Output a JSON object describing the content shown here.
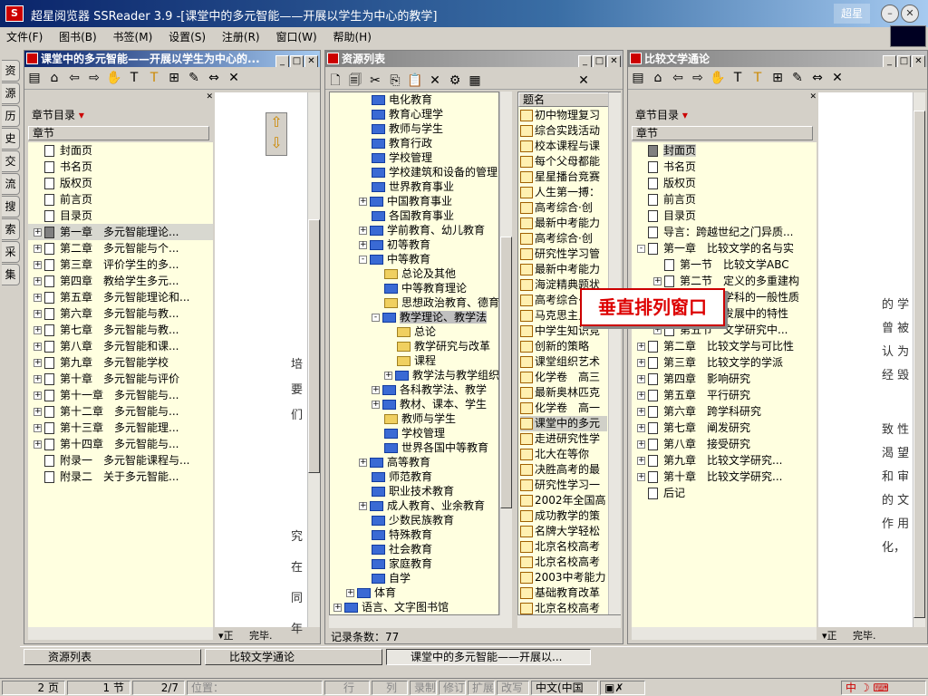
{
  "app": {
    "title": "超星阅览器 SSReader 3.9 -[课堂中的多元智能——开展以学生为中心的教学]",
    "logo_text": "超星"
  },
  "menu": [
    "文件(F)",
    "图书(B)",
    "书签(M)",
    "设置(S)",
    "注册(R)",
    "窗口(W)",
    "帮助(H)"
  ],
  "left_tabs": [
    "资",
    "源",
    "历",
    "史",
    "交",
    "流",
    "搜",
    "索",
    "采",
    "集"
  ],
  "pane1": {
    "title": "课堂中的多元智能——开展以学生为中心的...",
    "toc_dropdown": "章节目录",
    "column": "章节",
    "items": [
      {
        "label": "封面页",
        "expander": false
      },
      {
        "label": "书名页",
        "expander": false
      },
      {
        "label": "版权页",
        "expander": false
      },
      {
        "label": "前言页",
        "expander": false
      },
      {
        "label": "目录页",
        "expander": false
      },
      {
        "label": "第一章　多元智能理论...",
        "expander": true,
        "selected": true
      },
      {
        "label": "第二章　多元智能与个...",
        "expander": true
      },
      {
        "label": "第三章　评价学生的多...",
        "expander": true
      },
      {
        "label": "第四章　教给学生多元...",
        "expander": true
      },
      {
        "label": "第五章　多元智能理论和...",
        "expander": true
      },
      {
        "label": "第六章　多元智能与教...",
        "expander": true
      },
      {
        "label": "第七章　多元智能与教...",
        "expander": true
      },
      {
        "label": "第八章　多元智能和课...",
        "expander": true
      },
      {
        "label": "第九章　多元智能学校",
        "expander": true
      },
      {
        "label": "第十章　多元智能与评价",
        "expander": true
      },
      {
        "label": "第十一章　多元智能与...",
        "expander": true
      },
      {
        "label": "第十二章　多元智能与...",
        "expander": true
      },
      {
        "label": "第十三章　多元智能理...",
        "expander": true
      },
      {
        "label": "第十四章　多元智能与...",
        "expander": true
      },
      {
        "label": "附录一　多元智能课程与...",
        "expander": false
      },
      {
        "label": "附录二　关于多元智能...",
        "expander": false
      }
    ],
    "doc_chars": [
      "培",
      "要",
      "们",
      "究",
      "在",
      "同",
      "年",
      "在"
    ],
    "status": [
      "▾正",
      "完毕."
    ]
  },
  "pane2": {
    "title": "资源列表",
    "tree": [
      {
        "label": "电化教育",
        "indent": 3,
        "icon": "blue"
      },
      {
        "label": "教育心理学",
        "indent": 3,
        "icon": "blue"
      },
      {
        "label": "教师与学生",
        "indent": 3,
        "icon": "blue"
      },
      {
        "label": "教育行政",
        "indent": 3,
        "icon": "blue"
      },
      {
        "label": "学校管理",
        "indent": 3,
        "icon": "blue"
      },
      {
        "label": "学校建筑和设备的管理",
        "indent": 3,
        "icon": "blue"
      },
      {
        "label": "世界教育事业",
        "indent": 3,
        "icon": "blue"
      },
      {
        "label": "中国教育事业",
        "indent": 2,
        "icon": "tree",
        "ex": "+"
      },
      {
        "label": "各国教育事业",
        "indent": 3,
        "icon": "blue"
      },
      {
        "label": "学前教育、幼儿教育",
        "indent": 2,
        "icon": "tree",
        "ex": "+"
      },
      {
        "label": "初等教育",
        "indent": 2,
        "icon": "tree",
        "ex": "+"
      },
      {
        "label": "中等教育",
        "indent": 2,
        "icon": "tree",
        "ex": "-"
      },
      {
        "label": "总论及其他",
        "indent": 4,
        "icon": "yellow"
      },
      {
        "label": "中等教育理论",
        "indent": 4,
        "icon": "blue"
      },
      {
        "label": "思想政治教育、德育",
        "indent": 4,
        "icon": "yellow"
      },
      {
        "label": "教学理论、教学法",
        "indent": 3,
        "icon": "tree",
        "ex": "-",
        "selected": true
      },
      {
        "label": "总论",
        "indent": 5,
        "icon": "yellow"
      },
      {
        "label": "教学研究与改革",
        "indent": 5,
        "icon": "yellow"
      },
      {
        "label": "课程",
        "indent": 5,
        "icon": "yellow"
      },
      {
        "label": "教学法与教学组织",
        "indent": 4,
        "icon": "tree",
        "ex": "+"
      },
      {
        "label": "各科教学法、教学",
        "indent": 3,
        "icon": "tree",
        "ex": "+"
      },
      {
        "label": "教材、课本、学生",
        "indent": 3,
        "icon": "tree",
        "ex": "+"
      },
      {
        "label": "教师与学生",
        "indent": 4,
        "icon": "yellow"
      },
      {
        "label": "学校管理",
        "indent": 4,
        "icon": "blue"
      },
      {
        "label": "世界各国中等教育",
        "indent": 4,
        "icon": "blue"
      },
      {
        "label": "高等教育",
        "indent": 2,
        "icon": "tree",
        "ex": "+"
      },
      {
        "label": "师范教育",
        "indent": 3,
        "icon": "blue"
      },
      {
        "label": "职业技术教育",
        "indent": 3,
        "icon": "blue"
      },
      {
        "label": "成人教育、业余教育",
        "indent": 2,
        "icon": "tree",
        "ex": "+"
      },
      {
        "label": "少数民族教育",
        "indent": 3,
        "icon": "blue"
      },
      {
        "label": "特殊教育",
        "indent": 3,
        "icon": "blue"
      },
      {
        "label": "社会教育",
        "indent": 3,
        "icon": "blue"
      },
      {
        "label": "家庭教育",
        "indent": 3,
        "icon": "blue"
      },
      {
        "label": "自学",
        "indent": 3,
        "icon": "blue"
      },
      {
        "label": "体育",
        "indent": 1,
        "icon": "tree",
        "ex": "+"
      },
      {
        "label": "语言、文字图书馆",
        "indent": 0,
        "icon": "home",
        "ex": "+"
      }
    ],
    "list_header": "题名",
    "list": [
      "初中物理复习",
      "综合实践活动",
      "校本课程与课",
      "每个父母都能",
      "星星播台竞赛",
      "人生第一搏：",
      "高考综合·创",
      "最新中考能力",
      "高考综合·创",
      "研究性学习管",
      "最新中考能力",
      "海淀精典题状",
      "高考综合·创",
      "马克思主义",
      "中学生知识竞",
      "创新的策略",
      "课堂组织艺术",
      "化学卷　高三",
      "最新奥林匹克",
      "化学卷　高一",
      "课堂中的多元",
      "走进研究性学",
      "北大在等你",
      "决胜高考的最",
      "研究性学习一",
      "2002年全国高",
      "成功教学的策",
      "名牌大学轻松",
      "北京名校高考",
      "北京名校高考",
      "2003中考能力",
      "基础教育改革",
      "北京名校高考"
    ],
    "record_count": "记录条数：77"
  },
  "pane3": {
    "title": "比较文学通论",
    "toc_dropdown": "章节目录",
    "column": "章节",
    "items": [
      {
        "label": "封面页",
        "indent": 0,
        "selected": true
      },
      {
        "label": "书名页",
        "indent": 0
      },
      {
        "label": "版权页",
        "indent": 0
      },
      {
        "label": "前言页",
        "indent": 0
      },
      {
        "label": "目录页",
        "indent": 0
      },
      {
        "label": "导言：跨越世纪之门异质...",
        "indent": 0
      },
      {
        "label": "第一章　比较文学的名与实",
        "indent": 0,
        "ex": "-"
      },
      {
        "label": "第一节　比较文学ABC",
        "indent": 1
      },
      {
        "label": "第二节　定义的多重建构",
        "indent": 1,
        "ex": "+"
      },
      {
        "label": "第三节　学科的一般性质",
        "indent": 1,
        "ex": "+"
      },
      {
        "label": "第四节　发展中的特性",
        "indent": 1,
        "ex": "+"
      },
      {
        "label": "第五节　文学研究中...",
        "indent": 1,
        "ex": "+"
      },
      {
        "label": "第二章　比较文学与可比性",
        "indent": 0,
        "ex": "+"
      },
      {
        "label": "第三章　比较文学的学派",
        "indent": 0,
        "ex": "+"
      },
      {
        "label": "第四章　影响研究",
        "indent": 0,
        "ex": "+"
      },
      {
        "label": "第五章　平行研究",
        "indent": 0,
        "ex": "+"
      },
      {
        "label": "第六章　跨学科研究",
        "indent": 0,
        "ex": "+"
      },
      {
        "label": "第七章　阐发研究",
        "indent": 0,
        "ex": "+"
      },
      {
        "label": "第八章　接受研究",
        "indent": 0,
        "ex": "+"
      },
      {
        "label": "第九章　比较文学研究...",
        "indent": 0,
        "ex": "+"
      },
      {
        "label": "第十章　比较文学研究...",
        "indent": 0,
        "ex": "+"
      },
      {
        "label": "后记",
        "indent": 0
      }
    ],
    "doc_lines": [
      "的 学",
      "曾 被",
      "认 为",
      "经 毁",
      "",
      "致 性",
      "渴 望",
      "和 审",
      "的 文",
      "作 用",
      "化，"
    ],
    "status": [
      "▾正",
      "完毕."
    ]
  },
  "callout": "垂直排列窗口",
  "taskbar": [
    "资源列表",
    "比较文学通论",
    "课堂中的多元智能——开展以..."
  ],
  "statusbar": {
    "page": "2 页",
    "section": "1 节",
    "fraction": "2/7",
    "position": "位置：",
    "row": "行",
    "col": "列",
    "record": "录制",
    "revise": "修订",
    "extend": "扩展",
    "overwrite": "改写",
    "lang": "中文(中国",
    "ime": "中"
  }
}
